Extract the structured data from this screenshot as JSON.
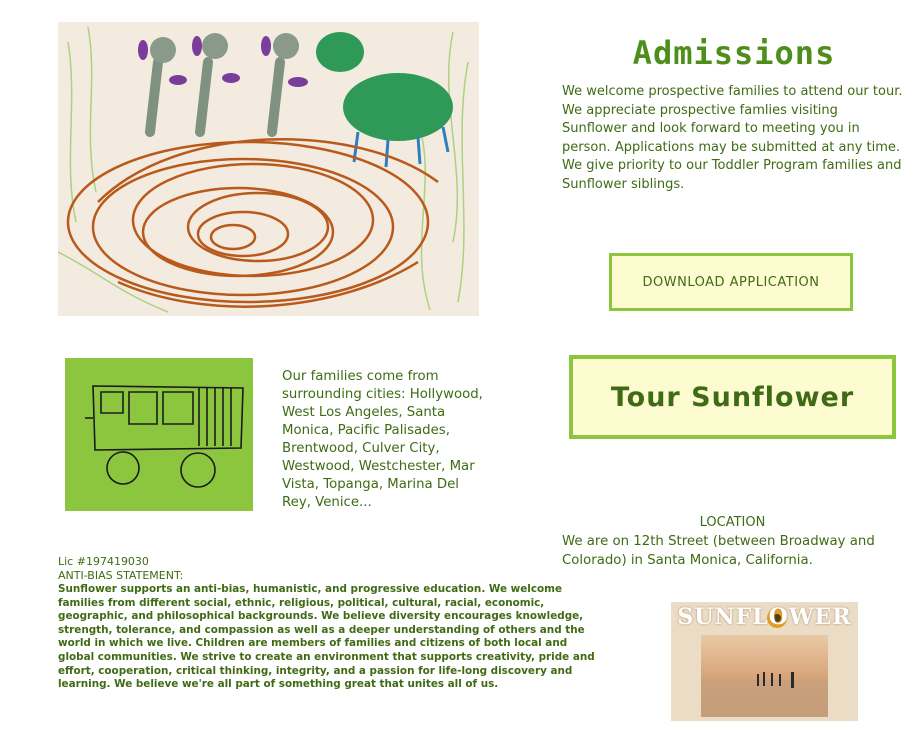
{
  "admissions": {
    "title": "Admissions",
    "text": "We welcome prospective families to attend our tour.  We appreciate prospective famlies visiting Sunflower and look forward to meeting you in person.  Applications may be submitted at any time.  We give priority to our Toddler Program families and Sunflower siblings."
  },
  "buttons": {
    "download": "DOWNLOAD APPLICATION",
    "tour": "Tour Sunflower"
  },
  "families": {
    "text": "Our families come from surrounding cities:  Hollywood, West Los Angeles, Santa Monica,  Pacific Palisades, Brentwood, Culver City, Westwood, Westchester, Mar Vista, Topanga, Marina Del Rey, Venice..."
  },
  "location": {
    "label": "LOCATION",
    "text": "We are on 12th Street (between Broadway and Colorado) in Santa Monica, California."
  },
  "license": "Lic #197419030",
  "antibias": {
    "title": "ANTI-BIAS STATEMENT:",
    "text": "Sunflower supports an anti-bias, humanistic, and progressive education. We welcome families from different social, ethnic, religious, political, cultural, racial, economic, geographic, and philosophical backgrounds. We believe diversity encourages knowledge, strength, tolerance, and compassion as well as a deeper understanding of others and the world in which we live. Children are members of families and citizens of both local and global communities. We strive to create an environment that supports creativity, pride and effort, cooperation, critical thinking, integrity, and a passion for life-long discovery and learning.  We believe we're all part of something great that unites all of us."
  },
  "photo": {
    "logo_text": "SUNFLOWER"
  },
  "colors": {
    "accent_green": "#8cc63f",
    "text_green": "#3f6b14",
    "button_bg": "#fdfcd1"
  }
}
